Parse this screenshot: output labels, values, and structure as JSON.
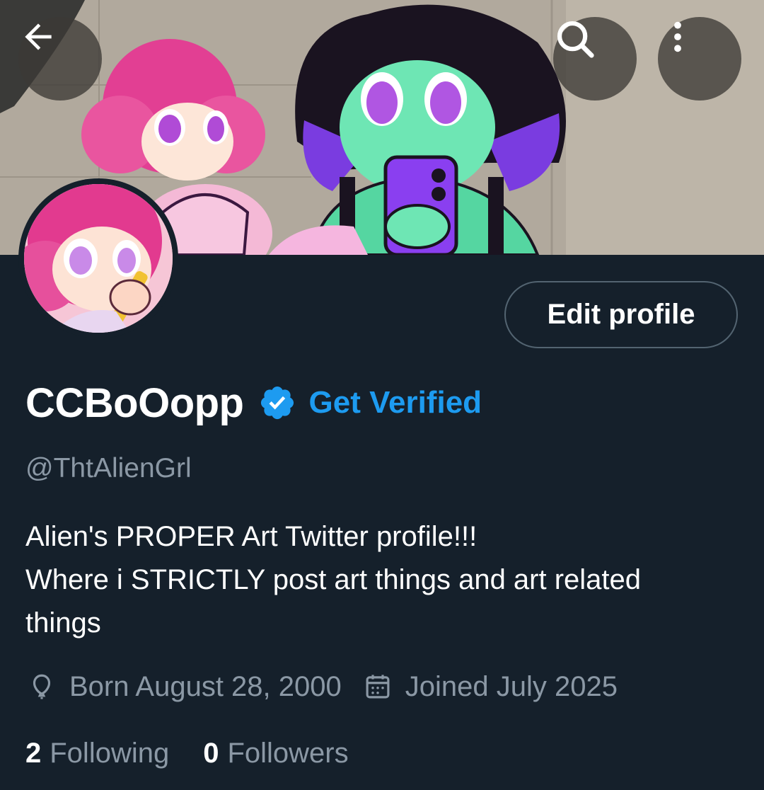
{
  "profile": {
    "display_name": "CCBoOopp",
    "get_verified_label": "Get Verified",
    "handle": "@ThtAlienGrl",
    "bio_lines": [
      "Alien's PROPER Art Twitter profile!!!",
      "Where i STRICTLY post art things and art related",
      "things"
    ],
    "location_birthday": "Born August 28, 2000",
    "joined": "Joined July 2025",
    "following_count": "2",
    "following_label": "Following",
    "followers_count": "0",
    "followers_label": "Followers"
  },
  "actions": {
    "edit_profile_label": "Edit profile"
  },
  "icons": {
    "back": "arrow-left-icon",
    "search": "search-icon",
    "more": "more-vertical-icon",
    "verified": "verified-badge-icon",
    "birthday": "balloon-icon",
    "calendar": "calendar-icon"
  },
  "colors": {
    "background": "#15202b",
    "accent": "#1d9bf0",
    "secondary_text": "#8b98a5",
    "border": "#536471"
  }
}
